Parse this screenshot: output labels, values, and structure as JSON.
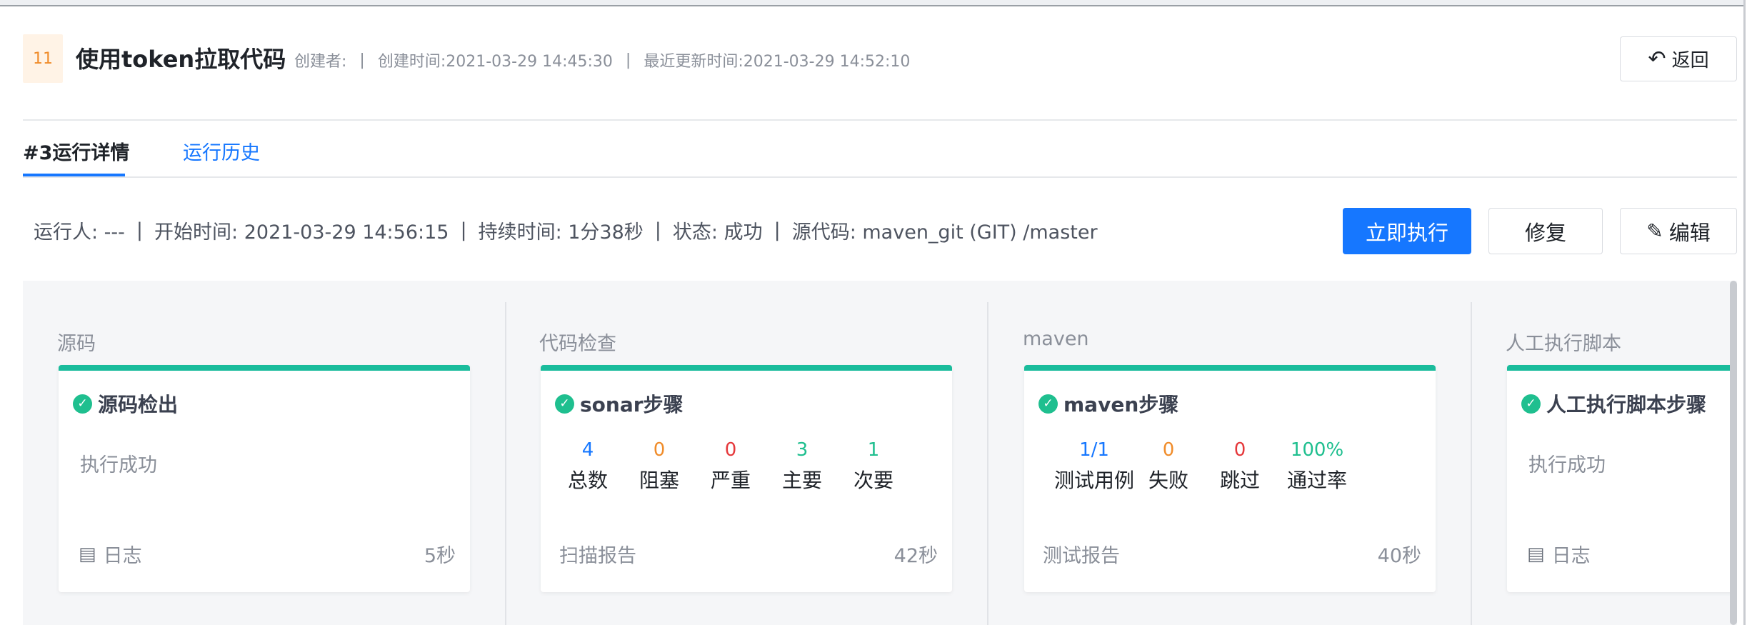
{
  "header": {
    "badge": "11",
    "title": "使用token拉取代码",
    "creator": "创建者:",
    "created_time": "创建时间:2021-03-29 14:45:30",
    "updated_time": "最近更新时间:2021-03-29 14:52:10",
    "separator": "|",
    "back_label": "返回"
  },
  "tabs": [
    {
      "label": "#3运行详情"
    },
    {
      "label": "运行历史"
    }
  ],
  "run_info": {
    "runner": "运行人: ---",
    "start_time": "开始时间: 2021-03-29 14:56:15",
    "duration": "持续时间: 1分38秒",
    "status": "状态: 成功",
    "source": "源代码: maven_git (GIT) /master",
    "separator": "|"
  },
  "actions": {
    "run_now": "立即执行",
    "repair": "修复",
    "edit": "编辑"
  },
  "stages": [
    {
      "name": "源码",
      "job": {
        "title": "源码检出",
        "status": "执行成功",
        "footer_label": "日志",
        "duration": "5秒"
      }
    },
    {
      "name": "代码检查",
      "job": {
        "title": "sonar步骤",
        "stats": [
          {
            "value": "4",
            "label": "总数",
            "color": "#1677ff"
          },
          {
            "value": "0",
            "label": "阻塞",
            "color": "#f08c2a"
          },
          {
            "value": "0",
            "label": "严重",
            "color": "#e5383b"
          },
          {
            "value": "3",
            "label": "主要",
            "color": "#1fbf8f"
          },
          {
            "value": "1",
            "label": "次要",
            "color": "#1fbf8f"
          }
        ],
        "footer_label": "扫描报告",
        "duration": "42秒"
      }
    },
    {
      "name": "maven",
      "job": {
        "title": "maven步骤",
        "stats": [
          {
            "value": "1/1",
            "label": "测试用例",
            "color": "#1677ff"
          },
          {
            "value": "0",
            "label": "失败",
            "color": "#f08c2a"
          },
          {
            "value": "0",
            "label": "跳过",
            "color": "#e5383b"
          },
          {
            "value": "100%",
            "label": "通过率",
            "color": "#1fbf8f"
          }
        ],
        "footer_label": "测试报告",
        "duration": "40秒"
      }
    },
    {
      "name": "人工执行脚本",
      "job": {
        "title": "人工执行脚本步骤",
        "status": "执行成功",
        "footer_label": "日志"
      }
    }
  ],
  "colors": {
    "primary": "#1677ff",
    "success": "#1fbf8f",
    "badge_bg": "#fff3e6",
    "badge_text": "#f08c2a"
  },
  "icons": {
    "back": "undo-arrow-icon",
    "edit": "pencil-icon",
    "status": "check-circle-icon",
    "log": "document-list-icon"
  }
}
